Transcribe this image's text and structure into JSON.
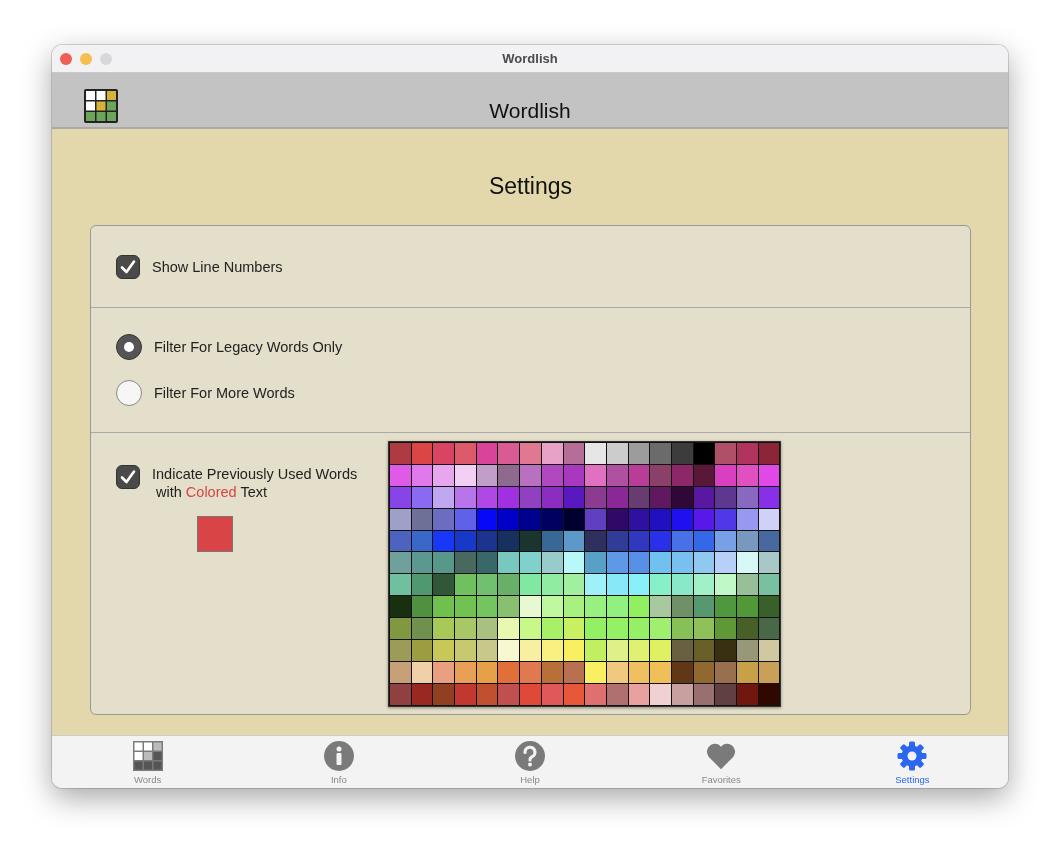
{
  "window": {
    "title": "Wordlish"
  },
  "header": {
    "title": "Wordlish"
  },
  "page_title": "Settings",
  "show_line_numbers": {
    "label": "Show Line Numbers",
    "checked": true
  },
  "filters": [
    {
      "label": "Filter For Legacy Words Only",
      "selected": true
    },
    {
      "label": "Filter For More Words",
      "selected": false
    }
  ],
  "indicate_used": {
    "checked": true,
    "label_start": "Indicate Previously Used Words",
    "label_with": "with",
    "label_highlight": "Colored",
    "label_end": "Text",
    "chosen_swatch": {
      "color": "#d94446"
    }
  },
  "palette": [
    {
      "swatches": [
        {
          "color": "#b03a42"
        },
        {
          "color": "#db4545"
        },
        {
          "color": "#d94463"
        },
        {
          "color": "#dd5a6a"
        },
        {
          "color": "#d9449a"
        },
        {
          "color": "#d95b94"
        },
        {
          "color": "#e07892"
        },
        {
          "color": "#e8a2c8"
        },
        {
          "color": "#b56e98"
        },
        {
          "color": "#e6e6e6"
        },
        {
          "color": "#cccccc"
        },
        {
          "color": "#9c9c9c"
        },
        {
          "color": "#6b6b6b"
        },
        {
          "color": "#3c3c3c"
        },
        {
          "color": "#000000"
        },
        {
          "color": "#b05066"
        },
        {
          "color": "#b0345e"
        },
        {
          "color": "#8a2638"
        }
      ]
    },
    {
      "swatches": [
        {
          "color": "#e05ae8"
        },
        {
          "color": "#e07aea"
        },
        {
          "color": "#e8a6ef"
        },
        {
          "color": "#f2d0f5"
        },
        {
          "color": "#c09ec8"
        },
        {
          "color": "#8f6a8f"
        },
        {
          "color": "#b870c0"
        },
        {
          "color": "#b048c0"
        },
        {
          "color": "#a838c0"
        },
        {
          "color": "#e070c0"
        },
        {
          "color": "#b050a0"
        },
        {
          "color": "#b83c98"
        },
        {
          "color": "#8a4068"
        },
        {
          "color": "#8c2868"
        },
        {
          "color": "#5a1838"
        },
        {
          "color": "#d840c0"
        },
        {
          "color": "#e050c0"
        },
        {
          "color": "#e048e8"
        }
      ]
    },
    {
      "swatches": [
        {
          "color": "#8844e8"
        },
        {
          "color": "#8a6af0"
        },
        {
          "color": "#c0a8f0"
        },
        {
          "color": "#b874e8"
        },
        {
          "color": "#b048e8"
        },
        {
          "color": "#a030e0"
        },
        {
          "color": "#9040c0"
        },
        {
          "color": "#8c2cc0"
        },
        {
          "color": "#5a18c0"
        },
        {
          "color": "#8c3c90"
        },
        {
          "color": "#8a2898"
        },
        {
          "color": "#683c70"
        },
        {
          "color": "#601860"
        },
        {
          "color": "#300838"
        },
        {
          "color": "#5818a0"
        },
        {
          "color": "#5c3890"
        },
        {
          "color": "#8868c0"
        },
        {
          "color": "#8830e8"
        }
      ]
    },
    {
      "swatches": [
        {
          "color": "#9ea0c8"
        },
        {
          "color": "#6e7098"
        },
        {
          "color": "#6c6cc0"
        },
        {
          "color": "#6060e8"
        },
        {
          "color": "#0808f8"
        },
        {
          "color": "#0000c8"
        },
        {
          "color": "#000090"
        },
        {
          "color": "#000060"
        },
        {
          "color": "#000030"
        },
        {
          "color": "#6040c0"
        },
        {
          "color": "#300868"
        },
        {
          "color": "#3010a0"
        },
        {
          "color": "#2010c0"
        },
        {
          "color": "#2010f0"
        },
        {
          "color": "#5818e8"
        },
        {
          "color": "#5038e8"
        },
        {
          "color": "#9898f0"
        },
        {
          "color": "#d0d0f8"
        }
      ]
    },
    {
      "swatches": [
        {
          "color": "#4c64c0"
        },
        {
          "color": "#3a68c8"
        },
        {
          "color": "#1838f8"
        },
        {
          "color": "#1838c8"
        },
        {
          "color": "#1c3490"
        },
        {
          "color": "#183060"
        },
        {
          "color": "#1c3430"
        },
        {
          "color": "#386898"
        },
        {
          "color": "#5c98c8"
        },
        {
          "color": "#303060"
        },
        {
          "color": "#303c98"
        },
        {
          "color": "#3038c0"
        },
        {
          "color": "#2830e8"
        },
        {
          "color": "#4870e8"
        },
        {
          "color": "#3468e8"
        },
        {
          "color": "#78a0e8"
        },
        {
          "color": "#7898c0"
        },
        {
          "color": "#4868a0"
        }
      ]
    },
    {
      "swatches": [
        {
          "color": "#70a09c"
        },
        {
          "color": "#5a9890"
        },
        {
          "color": "#58988a"
        },
        {
          "color": "#486860"
        },
        {
          "color": "#386868"
        },
        {
          "color": "#78c8c0"
        },
        {
          "color": "#80d0cc"
        },
        {
          "color": "#98cccc"
        },
        {
          "color": "#b8f8f8"
        },
        {
          "color": "#58a0c8"
        },
        {
          "color": "#6098e8"
        },
        {
          "color": "#5890e8"
        },
        {
          "color": "#70c0f0"
        },
        {
          "color": "#78c0f0"
        },
        {
          "color": "#90c8f0"
        },
        {
          "color": "#b8d0f8"
        },
        {
          "color": "#d8f8f8"
        },
        {
          "color": "#a8c8c8"
        }
      ]
    },
    {
      "swatches": [
        {
          "color": "#70c0a0"
        },
        {
          "color": "#509870"
        },
        {
          "color": "#305838"
        },
        {
          "color": "#70c060"
        },
        {
          "color": "#70c070"
        },
        {
          "color": "#68b068"
        },
        {
          "color": "#80e8a0"
        },
        {
          "color": "#90eca0"
        },
        {
          "color": "#a0f0a0"
        },
        {
          "color": "#a0f0f8"
        },
        {
          "color": "#88e8f8"
        },
        {
          "color": "#88f0f8"
        },
        {
          "color": "#88f0c8"
        },
        {
          "color": "#88e8c8"
        },
        {
          "color": "#a0f0c8"
        },
        {
          "color": "#c0f8c8"
        },
        {
          "color": "#98c098"
        },
        {
          "color": "#78c0a0"
        }
      ]
    },
    {
      "swatches": [
        {
          "color": "#183010"
        },
        {
          "color": "#509040"
        },
        {
          "color": "#70c050"
        },
        {
          "color": "#72c252"
        },
        {
          "color": "#74c460"
        },
        {
          "color": "#88c070"
        },
        {
          "color": "#e8f8d0"
        },
        {
          "color": "#c0f8a0"
        },
        {
          "color": "#a8f080"
        },
        {
          "color": "#98f080"
        },
        {
          "color": "#90f080"
        },
        {
          "color": "#90f060"
        },
        {
          "color": "#a8c8a0"
        },
        {
          "color": "#709068"
        },
        {
          "color": "#589870"
        },
        {
          "color": "#509840"
        },
        {
          "color": "#509838"
        },
        {
          "color": "#386028"
        }
      ]
    },
    {
      "swatches": [
        {
          "color": "#809840"
        },
        {
          "color": "#709050"
        },
        {
          "color": "#a8c858"
        },
        {
          "color": "#a8c868"
        },
        {
          "color": "#a8c080"
        },
        {
          "color": "#e8f8b0"
        },
        {
          "color": "#c8f888"
        },
        {
          "color": "#a8f068"
        },
        {
          "color": "#c8f060"
        },
        {
          "color": "#92f062"
        },
        {
          "color": "#94f064"
        },
        {
          "color": "#96f066"
        },
        {
          "color": "#a0f070"
        },
        {
          "color": "#88c058"
        },
        {
          "color": "#90c058"
        },
        {
          "color": "#609838"
        },
        {
          "color": "#486028"
        },
        {
          "color": "#486848"
        }
      ]
    },
    {
      "swatches": [
        {
          "color": "#9c9c58"
        },
        {
          "color": "#9c9c40"
        },
        {
          "color": "#c8c858"
        },
        {
          "color": "#c8c870"
        },
        {
          "color": "#c8c888"
        },
        {
          "color": "#f8f8d0"
        },
        {
          "color": "#f8f0a0"
        },
        {
          "color": "#f8f080"
        },
        {
          "color": "#f8f060"
        },
        {
          "color": "#c0f060"
        },
        {
          "color": "#e0f088"
        },
        {
          "color": "#e0f070"
        },
        {
          "color": "#e0f060"
        },
        {
          "color": "#686040"
        },
        {
          "color": "#686028"
        },
        {
          "color": "#383010"
        },
        {
          "color": "#989878"
        },
        {
          "color": "#d0c8a0"
        }
      ]
    },
    {
      "swatches": [
        {
          "color": "#c8a078"
        },
        {
          "color": "#f0d0a8"
        },
        {
          "color": "#e8a080"
        },
        {
          "color": "#e8a058"
        },
        {
          "color": "#e8a048"
        },
        {
          "color": "#e07038"
        },
        {
          "color": "#e07850"
        },
        {
          "color": "#b87038"
        },
        {
          "color": "#b87050"
        },
        {
          "color": "#f8f062"
        },
        {
          "color": "#f0c880"
        },
        {
          "color": "#f0c060"
        },
        {
          "color": "#f0c058"
        },
        {
          "color": "#603818"
        },
        {
          "color": "#906830"
        },
        {
          "color": "#987050"
        },
        {
          "color": "#c8a048"
        },
        {
          "color": "#c8a058"
        }
      ]
    },
    {
      "swatches": [
        {
          "color": "#904040"
        },
        {
          "color": "#982820"
        },
        {
          "color": "#904020"
        },
        {
          "color": "#c03830"
        },
        {
          "color": "#c05030"
        },
        {
          "color": "#c05050"
        },
        {
          "color": "#e04838"
        },
        {
          "color": "#e05858"
        },
        {
          "color": "#e85838"
        },
        {
          "color": "#e07070"
        },
        {
          "color": "#b07070"
        },
        {
          "color": "#e8a0a0"
        },
        {
          "color": "#f0d0d0"
        },
        {
          "color": "#c8a0a0"
        },
        {
          "color": "#987070"
        },
        {
          "color": "#604040"
        },
        {
          "color": "#701810"
        },
        {
          "color": "#300800"
        }
      ]
    }
  ],
  "tabs": [
    {
      "label": "Words",
      "kind": "grid",
      "selected": false
    },
    {
      "label": "Info",
      "kind": "info",
      "selected": false
    },
    {
      "label": "Help",
      "kind": "help",
      "selected": false
    },
    {
      "label": "Favorites",
      "kind": "heart",
      "selected": false
    },
    {
      "label": "Settings",
      "kind": "gear",
      "selected": true
    }
  ]
}
